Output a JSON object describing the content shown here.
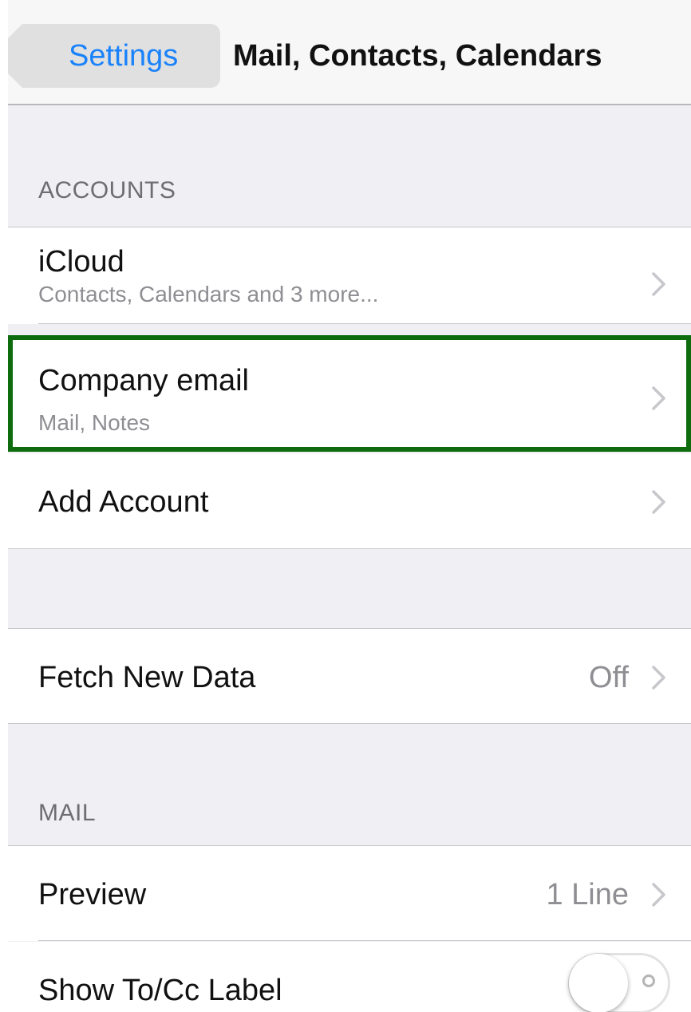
{
  "navbar": {
    "back_label": "Settings",
    "title": "Mail, Contacts, Calendars"
  },
  "accounts": {
    "header": "ACCOUNTS",
    "items": [
      {
        "title": "iCloud",
        "subtitle": "Contacts, Calendars and 3 more..."
      },
      {
        "title": "Company email",
        "subtitle": "Mail, Notes"
      },
      {
        "title": "Add Account"
      }
    ]
  },
  "fetch": {
    "title": "Fetch New Data",
    "value": "Off"
  },
  "mail": {
    "header": "MAIL",
    "preview": {
      "title": "Preview",
      "value": "1 Line"
    },
    "show_tocc": {
      "title": "Show To/Cc Label",
      "enabled": false
    }
  },
  "colors": {
    "accent": "#1a82fb",
    "highlight": "#0e6b0e",
    "background": "#efeff4"
  },
  "icons": {
    "chevron": "chevron-right-icon",
    "back": "back-arrow-icon"
  }
}
